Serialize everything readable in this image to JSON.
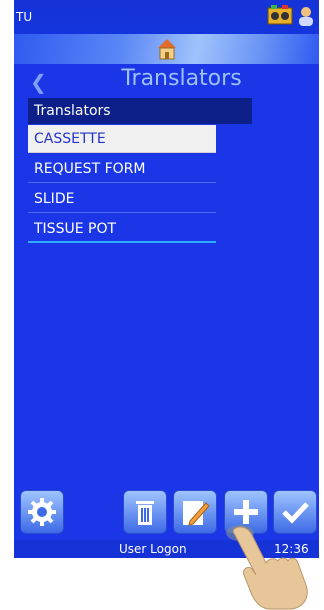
{
  "statusbar": {
    "left_text": "TU"
  },
  "header": {
    "title": "Translators",
    "back_icon": "chevron-left-icon",
    "home_icon": "home-icon"
  },
  "list": {
    "header": "Translators",
    "items": [
      {
        "label": "CASSETTE",
        "selected": true
      },
      {
        "label": "REQUEST FORM",
        "selected": false
      },
      {
        "label": "SLIDE",
        "selected": false
      },
      {
        "label": "TISSUE POT",
        "selected": false
      }
    ]
  },
  "toolbar": {
    "settings_icon": "gear-icon",
    "delete_icon": "trash-icon",
    "edit_icon": "edit-icon",
    "add_icon": "plus-icon",
    "confirm_icon": "check-icon"
  },
  "footer": {
    "user_label": "User Logon",
    "time": "12:36"
  },
  "colors": {
    "background": "#1a36e6",
    "header_bar": "#0d1f88",
    "selected_row": "#f0f0f0",
    "title": "#9fc1ff"
  }
}
